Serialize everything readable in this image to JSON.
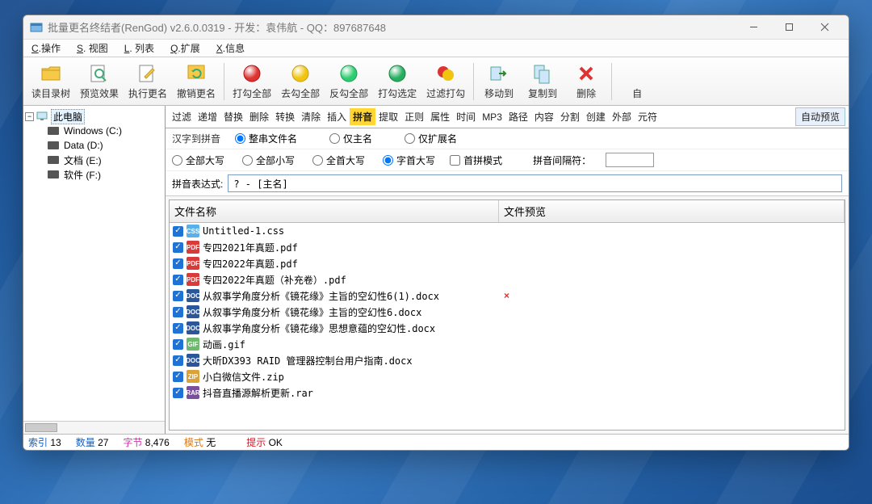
{
  "title": "批量更名终结者(RenGod) v2.6.0.0319 - 开发：袁伟航 - QQ：897687648",
  "menus": [
    "C.操作",
    "S. 视图",
    "L. 列表",
    "Q.扩展",
    "X.信息"
  ],
  "toolbar": [
    {
      "id": "read-tree",
      "label": "读目录树",
      "icon": "folder"
    },
    {
      "id": "preview",
      "label": "预览效果",
      "icon": "magnify"
    },
    {
      "id": "exec",
      "label": "执行更名",
      "icon": "pencil"
    },
    {
      "id": "undo",
      "label": "撤销更名",
      "icon": "undo"
    },
    {
      "sep": true
    },
    {
      "id": "check-all",
      "label": "打勾全部",
      "icon": "ball-red"
    },
    {
      "id": "uncheck-all",
      "label": "去勾全部",
      "icon": "ball-yellow"
    },
    {
      "id": "invert",
      "label": "反勾全部",
      "icon": "ball-green"
    },
    {
      "id": "check-sel",
      "label": "打勾选定",
      "icon": "ball-green2"
    },
    {
      "id": "filter-check",
      "label": "过滤打勾",
      "icon": "ball-mix"
    },
    {
      "sep": true
    },
    {
      "id": "move-to",
      "label": "移动到",
      "icon": "moveto"
    },
    {
      "id": "copy-to",
      "label": "复制到",
      "icon": "copyto"
    },
    {
      "id": "delete",
      "label": "删除",
      "icon": "delete"
    },
    {
      "sep": true
    },
    {
      "id": "auto",
      "label": "自",
      "icon": ""
    }
  ],
  "tree": {
    "root": "此电脑",
    "children": [
      {
        "label": "Windows (C:)"
      },
      {
        "label": "Data (D:)"
      },
      {
        "label": "文档 (E:)"
      },
      {
        "label": "软件 (F:)"
      }
    ]
  },
  "tabs": [
    "过滤",
    "递增",
    "替换",
    "删除",
    "转换",
    "清除",
    "插入",
    "拼音",
    "提取",
    "正则",
    "属性",
    "时间",
    "MP3",
    "路径",
    "内容",
    "分割",
    "创建",
    "外部",
    "元符"
  ],
  "active_tab": "拼音",
  "auto_preview": "自动预览",
  "row1": {
    "label": "汉字到拼音",
    "opts": [
      "整串文件名",
      "仅主名",
      "仅扩展名"
    ],
    "checked": 0
  },
  "row2": {
    "opts": [
      "全部大写",
      "全部小写",
      "全首大写",
      "字首大写"
    ],
    "checked": 3,
    "chk_label": "首拼模式",
    "sep_label": "拼音间隔符："
  },
  "expr": {
    "label": "拼音表达式:",
    "value": "? - [主名]"
  },
  "cols": {
    "name": "文件名称",
    "prev": "文件预览"
  },
  "files": [
    {
      "name": "Untitled-1.css",
      "type": "css",
      "prev": ""
    },
    {
      "name": "专四2021年真题.pdf",
      "type": "pdf",
      "prev": ""
    },
    {
      "name": "专四2022年真题.pdf",
      "type": "pdf",
      "prev": ""
    },
    {
      "name": "专四2022年真题（补充卷）.pdf",
      "type": "pdf",
      "prev": ""
    },
    {
      "name": "从叙事学角度分析《镜花缘》主旨的空幻性6(1).docx",
      "type": "doc",
      "prev": "×"
    },
    {
      "name": "从叙事学角度分析《镜花缘》主旨的空幻性6.docx",
      "type": "doc",
      "prev": ""
    },
    {
      "name": "从叙事学角度分析《镜花缘》思想意蕴的空幻性.docx",
      "type": "doc",
      "prev": ""
    },
    {
      "name": "动画.gif",
      "type": "gif",
      "prev": ""
    },
    {
      "name": "大昕DX393 RAID 管理器控制台用户指南.docx",
      "type": "doc",
      "prev": ""
    },
    {
      "name": "小白微信文件.zip",
      "type": "zip",
      "prev": ""
    },
    {
      "name": "抖音直播源解析更新.rar",
      "type": "rar",
      "prev": ""
    }
  ],
  "status": {
    "idx_lbl": "索引",
    "idx": "13",
    "cnt_lbl": "数量",
    "cnt": "27",
    "bytes_lbl": "字节",
    "bytes": "8,476",
    "mode_lbl": "模式",
    "mode": "无",
    "hint_lbl": "提示",
    "hint": "OK"
  }
}
